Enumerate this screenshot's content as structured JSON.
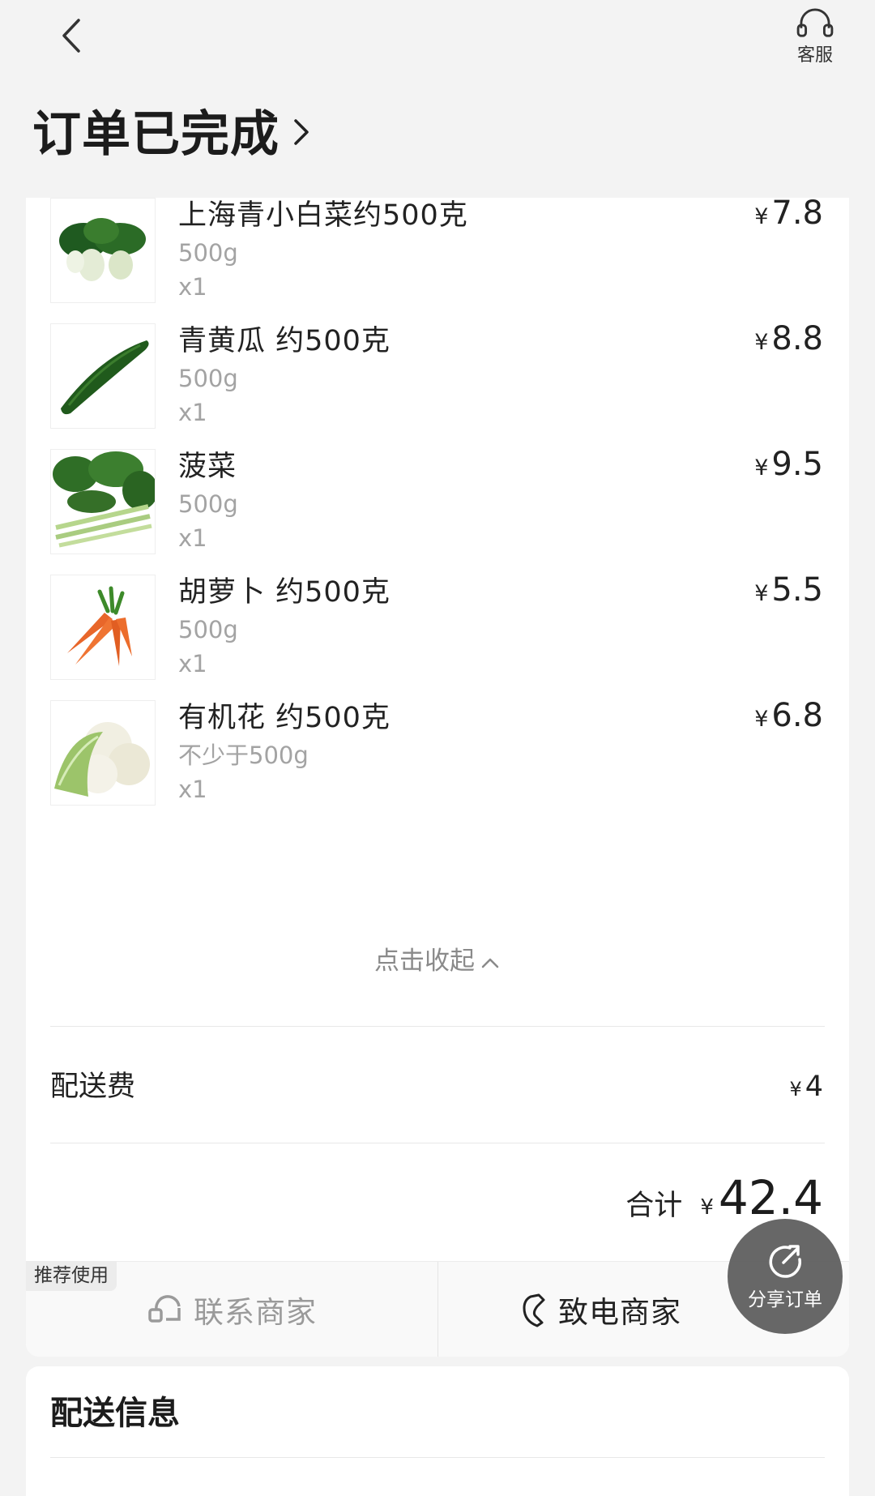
{
  "header": {
    "customer_service_label": "客服",
    "order_status": "订单已完成"
  },
  "items": [
    {
      "name": "上海青小白菜约500克",
      "spec": "500g",
      "qty": "x1",
      "currency": "¥",
      "price": "7.8",
      "image": "bok-choy"
    },
    {
      "name": "青黄瓜 约500克",
      "spec": "500g",
      "qty": "x1",
      "currency": "¥",
      "price": "8.8",
      "image": "cucumber"
    },
    {
      "name": "菠菜",
      "spec": "500g",
      "qty": "x1",
      "currency": "¥",
      "price": "9.5",
      "image": "spinach"
    },
    {
      "name": "胡萝卜 约500克",
      "spec": "500g",
      "qty": "x1",
      "currency": "¥",
      "price": "5.5",
      "image": "carrot"
    },
    {
      "name": "有机花 约500克",
      "spec": "不少于500g",
      "qty": "x1",
      "currency": "¥",
      "price": "6.8",
      "image": "cauliflower"
    }
  ],
  "collapse_label": "点击收起",
  "delivery_fee": {
    "label": "配送费",
    "currency": "¥",
    "value": "4"
  },
  "total": {
    "label": "合计",
    "currency": "¥",
    "value": "42.4"
  },
  "contact_bar": {
    "badge": "推荐使用",
    "contact_label": "联系商家",
    "call_label": "致电商家"
  },
  "share_label": "分享订单",
  "delivery_info": {
    "title": "配送信息"
  },
  "colors": {
    "background": "#f3f3f3",
    "card": "#ffffff",
    "muted_text": "#a3a3a3",
    "fab": "#5a5a5a"
  }
}
